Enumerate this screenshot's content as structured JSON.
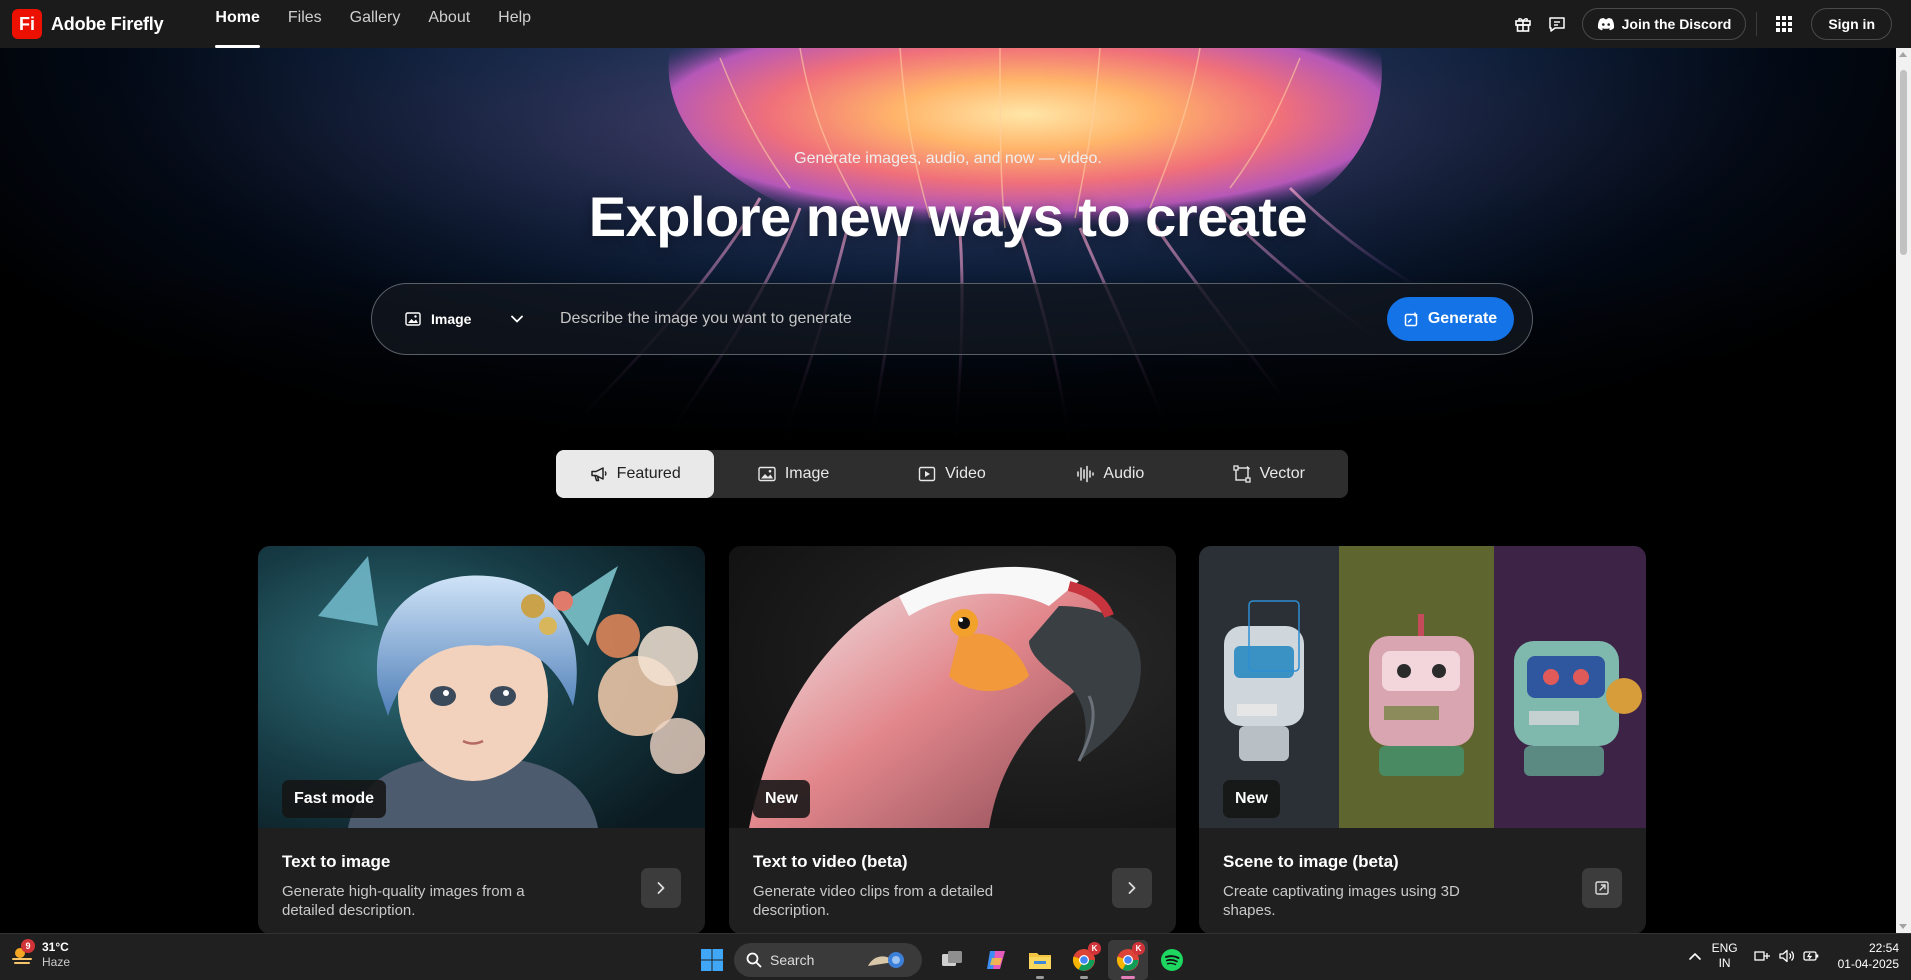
{
  "app": {
    "name": "Adobe Firefly",
    "logo_text": "Fi"
  },
  "nav": {
    "items": [
      {
        "label": "Home",
        "active": true
      },
      {
        "label": "Files"
      },
      {
        "label": "Gallery"
      },
      {
        "label": "About"
      },
      {
        "label": "Help"
      }
    ]
  },
  "top_right": {
    "gift_icon": "gift-icon",
    "feedback_icon": "chat-bubble-icon",
    "discord_label": "Join the Discord",
    "apps_icon": "app-grid-icon",
    "signin_label": "Sign in"
  },
  "hero": {
    "subtitle": "Generate images, audio, and now — video.",
    "title": "Explore new ways to create"
  },
  "prompt": {
    "type_label": "Image",
    "placeholder": "Describe the image you want to generate",
    "value": "",
    "generate_label": "Generate"
  },
  "tabs": [
    {
      "label": "Featured",
      "icon": "megaphone-icon",
      "active": true
    },
    {
      "label": "Image",
      "icon": "image-icon"
    },
    {
      "label": "Video",
      "icon": "video-icon"
    },
    {
      "label": "Audio",
      "icon": "audio-wave-icon"
    },
    {
      "label": "Vector",
      "icon": "vector-icon"
    }
  ],
  "cards": [
    {
      "badge": "Fast mode",
      "title": "Text to image",
      "description": "Generate high-quality images from a detailed description.",
      "action_icon": "chevron-right-icon"
    },
    {
      "badge": "New",
      "title": "Text to video (beta)",
      "description": "Generate video clips from a detailed description.",
      "action_icon": "chevron-right-icon"
    },
    {
      "badge": "New",
      "title": "Scene to image (beta)",
      "description": "Create captivating images using 3D shapes.",
      "action_icon": "open-external-icon"
    }
  ],
  "taskbar": {
    "weather": {
      "temp": "31°C",
      "condition": "Haze",
      "badge": "9"
    },
    "search_label": "Search",
    "apps": [
      "windows-start-icon",
      "task-view-icon",
      "copilot-icon",
      "file-explorer-icon",
      "chrome-icon",
      "chrome-icon",
      "spotify-icon"
    ],
    "chrome_badge": "K",
    "lang": {
      "line1": "ENG",
      "line2": "IN"
    },
    "clock": {
      "time": "22:54",
      "date": "01-04-2025"
    }
  },
  "colors": {
    "brand_red": "#eb1000",
    "generate_blue": "#1473e6",
    "topbar_bg": "#1b1b1b",
    "card_bg": "#1f1f1f"
  }
}
